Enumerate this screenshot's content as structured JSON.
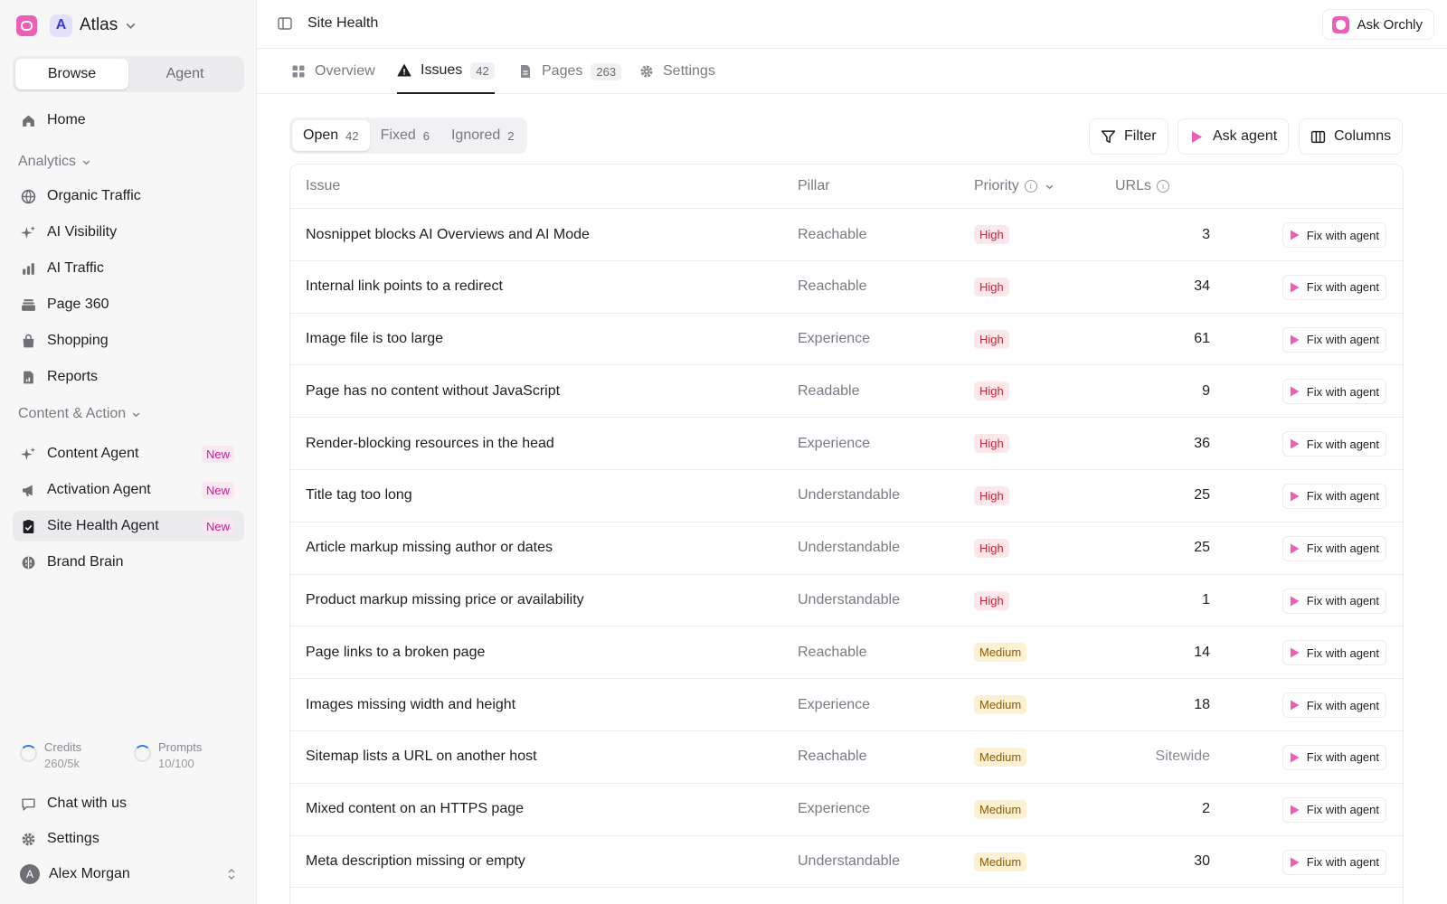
{
  "workspace": {
    "badge": "A",
    "name": "Atlas"
  },
  "sidebar": {
    "tabs": [
      "Browse",
      "Agent"
    ],
    "items_top": [
      {
        "label": "Home",
        "icon": "home-icon"
      }
    ],
    "analytics_heading": "Analytics",
    "analytics": [
      {
        "label": "Organic Traffic",
        "icon": "globe-icon"
      },
      {
        "label": "AI Visibility",
        "icon": "sparkle-icon"
      },
      {
        "label": "AI Traffic",
        "icon": "bar-chart-icon"
      },
      {
        "label": "Page 360",
        "icon": "layers-icon"
      },
      {
        "label": "Shopping",
        "icon": "shopping-bag-icon"
      },
      {
        "label": "Reports",
        "icon": "report-icon"
      }
    ],
    "content_heading": "Content & Action",
    "content": [
      {
        "label": "Content Agent",
        "icon": "sparkle-icon",
        "badge": "New"
      },
      {
        "label": "Activation Agent",
        "icon": "megaphone-icon",
        "badge": "New"
      },
      {
        "label": "Site Health Agent",
        "icon": "clipboard-check-icon",
        "badge": "New",
        "active": true
      },
      {
        "label": "Brand Brain",
        "icon": "brain-icon"
      }
    ],
    "usage": [
      {
        "label": "Credits",
        "value": "260/5k",
        "fraction": 0.052
      },
      {
        "label": "Prompts",
        "value": "10/100",
        "fraction": 0.1
      }
    ],
    "bottom": [
      {
        "label": "Chat with us",
        "icon": "chat-icon"
      },
      {
        "label": "Settings",
        "icon": "gear-icon"
      }
    ],
    "user": {
      "initial": "A",
      "name": "Alex Morgan"
    }
  },
  "header": {
    "title": "Site Health",
    "ask_label": "Ask Orchly"
  },
  "tabs": [
    {
      "label": "Overview",
      "icon": "grid-icon"
    },
    {
      "label": "Issues",
      "icon": "warning-icon",
      "count": "42",
      "active": true
    },
    {
      "label": "Pages",
      "icon": "document-icon",
      "count": "263"
    },
    {
      "label": "Settings",
      "icon": "gear-icon"
    }
  ],
  "status_filter": [
    {
      "label": "Open",
      "count": "42",
      "active": true
    },
    {
      "label": "Fixed",
      "count": "6"
    },
    {
      "label": "Ignored",
      "count": "2"
    }
  ],
  "toolbar": {
    "filter": "Filter",
    "ask_agent": "Ask agent",
    "columns": "Columns"
  },
  "table": {
    "columns": {
      "issue": "Issue",
      "pillar": "Pillar",
      "priority": "Priority",
      "urls": "URLs"
    },
    "fix_label": "Fix with agent",
    "rows": [
      {
        "issue": "Nosnippet blocks AI Overviews and AI Mode",
        "pillar": "Reachable",
        "priority": "High",
        "urls": "3"
      },
      {
        "issue": "Internal link points to a redirect",
        "pillar": "Reachable",
        "priority": "High",
        "urls": "34"
      },
      {
        "issue": "Image file is too large",
        "pillar": "Experience",
        "priority": "High",
        "urls": "61"
      },
      {
        "issue": "Page has no content without JavaScript",
        "pillar": "Readable",
        "priority": "High",
        "urls": "9"
      },
      {
        "issue": "Render-blocking resources in the head",
        "pillar": "Experience",
        "priority": "High",
        "urls": "36"
      },
      {
        "issue": "Title tag too long",
        "pillar": "Understandable",
        "priority": "High",
        "urls": "25"
      },
      {
        "issue": "Article markup missing author or dates",
        "pillar": "Understandable",
        "priority": "High",
        "urls": "25"
      },
      {
        "issue": "Product markup missing price or availability",
        "pillar": "Understandable",
        "priority": "High",
        "urls": "1"
      },
      {
        "issue": "Page links to a broken page",
        "pillar": "Reachable",
        "priority": "Medium",
        "urls": "14"
      },
      {
        "issue": "Images missing width and height",
        "pillar": "Experience",
        "priority": "Medium",
        "urls": "18"
      },
      {
        "issue": "Sitemap lists a URL on another host",
        "pillar": "Reachable",
        "priority": "Medium",
        "urls": "Sitewide"
      },
      {
        "issue": "Mixed content on an HTTPS page",
        "pillar": "Experience",
        "priority": "Medium",
        "urls": "2"
      },
      {
        "issue": "Meta description missing or empty",
        "pillar": "Understandable",
        "priority": "Medium",
        "urls": "30"
      }
    ]
  },
  "colors": {
    "accent": "#ec5fb9",
    "high_text": "#c2253a",
    "high_bg": "#fce8ea",
    "medium_text": "#8a5a08",
    "medium_bg": "#fdf1d2",
    "new_badge": "#c61f8a"
  }
}
